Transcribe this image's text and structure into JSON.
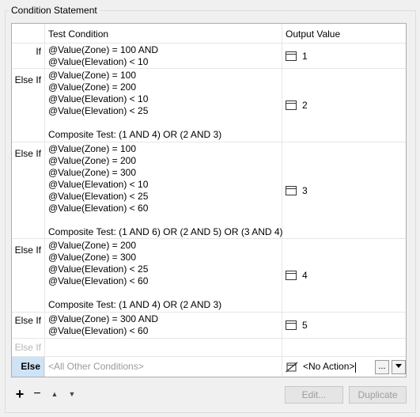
{
  "group": {
    "title": "Condition Statement"
  },
  "columns": {
    "test": "Test Condition",
    "output": "Output Value"
  },
  "rows": [
    {
      "label": "If",
      "lines": [
        "@Value(Zone) = 100 AND",
        "@Value(Elevation) < 10"
      ],
      "output": "1"
    },
    {
      "label": "Else If",
      "lines": [
        "@Value(Zone) = 100",
        "@Value(Zone) = 200",
        "@Value(Elevation) < 10",
        "@Value(Elevation) < 25",
        "",
        "Composite Test: (1 AND 4) OR (2 AND 3)"
      ],
      "output": "2"
    },
    {
      "label": "Else If",
      "lines": [
        "@Value(Zone) = 100",
        "@Value(Zone) = 200",
        "@Value(Zone) = 300",
        "@Value(Elevation) < 10",
        "@Value(Elevation) < 25",
        "@Value(Elevation) < 60",
        "",
        "Composite Test: (1 AND 6) OR (2 AND 5) OR (3 AND 4)"
      ],
      "output": "3"
    },
    {
      "label": "Else If",
      "lines": [
        "@Value(Zone) = 200",
        "@Value(Zone) = 300",
        "@Value(Elevation) < 25",
        "@Value(Elevation) < 60",
        "",
        "Composite Test: (1 AND 4) OR (2 AND 3)"
      ],
      "output": "4"
    },
    {
      "label": "Else If",
      "lines": [
        "@Value(Zone) = 300 AND",
        "@Value(Elevation) < 60"
      ],
      "output": "5"
    }
  ],
  "empty_row": {
    "label": "Else If"
  },
  "else_row": {
    "label": "Else",
    "placeholder": "<All Other Conditions>",
    "output": "<No Action>",
    "more_button": "..."
  },
  "toolbar": {
    "add": "+",
    "remove": "−",
    "up": "▲",
    "down": "▼"
  },
  "buttons": {
    "edit": "Edit...",
    "duplicate": "Duplicate"
  },
  "icons": {
    "output_icon": "attribute-value-icon",
    "no_action_icon": "no-action-icon",
    "dropdown_icon": "chevron-down-icon"
  },
  "colors": {
    "else_header_bg": "#cfe3f7",
    "disabled_text": "#9d9d9d"
  }
}
